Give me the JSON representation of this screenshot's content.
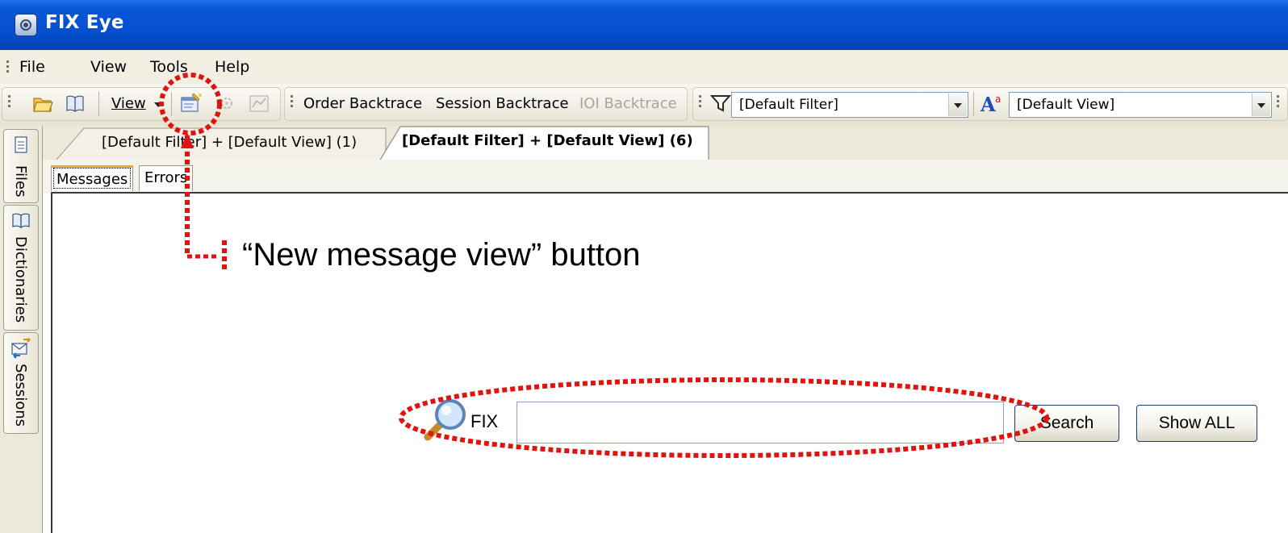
{
  "window": {
    "title": "FIX Eye"
  },
  "menu": {
    "items": [
      {
        "label": "File"
      },
      {
        "label": "View"
      },
      {
        "label": "Tools"
      },
      {
        "label": "Help"
      }
    ]
  },
  "toolbar": {
    "view_dropdown_label": "View",
    "order_backtrace_label": "Order Backtrace",
    "session_backtrace_label": "Session Backtrace",
    "ioi_backtrace_label": "IOI Backtrace",
    "filter_combo_value": "[Default Filter]",
    "view_combo_value": "[Default View]"
  },
  "sidebar": {
    "tabs": [
      {
        "label": "Files",
        "icon": "document-icon"
      },
      {
        "label": "Dictionaries",
        "icon": "book-icon"
      },
      {
        "label": "Sessions",
        "icon": "sessions-icon"
      }
    ]
  },
  "document_tabs": [
    {
      "label": "[Default Filter] + [Default View] (1)",
      "active": false
    },
    {
      "label": "[Default Filter] + [Default View] (6)",
      "active": true
    }
  ],
  "inner_tabs": [
    {
      "label": "Messages",
      "active": true
    },
    {
      "label": "Errors",
      "active": false
    }
  ],
  "search": {
    "prefix_label": "FIX",
    "input_value": "",
    "search_button_label": "Search",
    "show_all_button_label": "Show ALL"
  },
  "annotation": {
    "text": "“New message view” button",
    "color": "#e0130f"
  },
  "colors": {
    "titlebar": "#0550d0",
    "chrome": "#ece9d8",
    "annotation": "#e0130f"
  }
}
